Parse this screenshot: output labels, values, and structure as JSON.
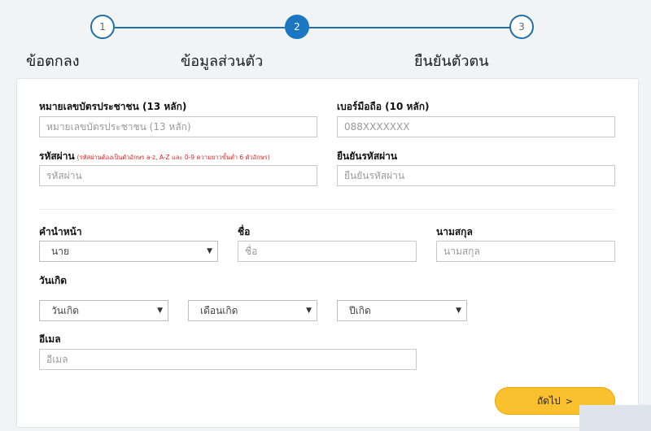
{
  "stepper": {
    "steps": [
      {
        "number": "1",
        "label": "ข้อตกลง"
      },
      {
        "number": "2",
        "label": "ข้อมูลส่วนตัว"
      },
      {
        "number": "3",
        "label": "ยืนยันตัวตน"
      }
    ],
    "active_step": 2
  },
  "account": {
    "id_card": {
      "label": "หมายเลขบัตรประชาชน (13 หลัก)",
      "placeholder": "หมายเลขบัตรประชาชน (13 หลัก)"
    },
    "mobile": {
      "label": "เบอร์มือถือ (10 หลัก)",
      "placeholder": "088XXXXXXX"
    },
    "password": {
      "label": "รหัสผ่าน",
      "hint": "(รหัสผ่านต้องเป็นตัวอักษร a-z, A-Z และ 0-9 ความยาวขั้นต่ำ 6 ตัวอักษร)",
      "placeholder": "รหัสผ่าน"
    },
    "confirm_password": {
      "label": "ยืนยันรหัสผ่าน",
      "placeholder": "ยืนยันรหัสผ่าน"
    }
  },
  "personal": {
    "prefix": {
      "label": "คำนำหน้า",
      "value": "นาย"
    },
    "first_name": {
      "label": "ชื่อ",
      "placeholder": "ชื่อ"
    },
    "last_name": {
      "label": "นามสกุล",
      "placeholder": "นามสกุล"
    },
    "birthdate": {
      "label": "วันเกิด",
      "day": "วันเกิด",
      "month": "เดือนเกิด",
      "year": "ปีเกิด"
    },
    "email": {
      "label": "อีเมล",
      "placeholder": "อีเมล"
    }
  },
  "actions": {
    "next_label": "ถัดไป",
    "next_icon": "chevron-right-icon"
  },
  "colors": {
    "primary": "#1a78c2",
    "button": "#fbc02d",
    "hint": "#e4231f"
  }
}
